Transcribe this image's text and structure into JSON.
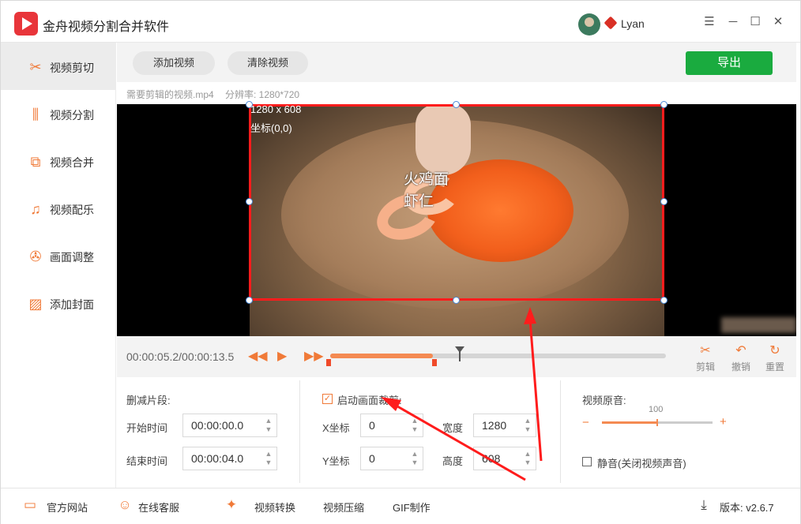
{
  "app": {
    "title": "金舟视频分割合并软件",
    "username": "Lyan"
  },
  "window": {
    "menu_icon": "hamburger-icon",
    "min_icon": "minimize-icon",
    "max_icon": "maximize-icon",
    "close_icon": "close-icon"
  },
  "sidebar": {
    "items": [
      {
        "label": "视频剪切",
        "icon": "scissors-icon",
        "active": true
      },
      {
        "label": "视频分割",
        "icon": "split-icon",
        "active": false
      },
      {
        "label": "视频合并",
        "icon": "merge-icon",
        "active": false
      },
      {
        "label": "视频配乐",
        "icon": "music-icon",
        "active": false
      },
      {
        "label": "画面调整",
        "icon": "film-reel-icon",
        "active": false
      },
      {
        "label": "添加封面",
        "icon": "image-icon",
        "active": false
      }
    ]
  },
  "toolbar": {
    "add_video": "添加视频",
    "clear_video": "清除视频",
    "export": "导出"
  },
  "file": {
    "name": "需要剪辑的视频.mp4",
    "resolution": "分辨率: 1280*720"
  },
  "preview": {
    "crop_size": "1280 x 608",
    "crop_coord": "坐标(0,0)",
    "subtitle_line1": "火鸡面",
    "subtitle_line2": "虾仁"
  },
  "playback": {
    "timecode": "00:00:05.2/00:00:13.5",
    "progress": 0.385,
    "played": 0.305,
    "segment_start": 0.0,
    "segment_end": 0.31
  },
  "tools": {
    "cut": "剪辑",
    "undo": "撤销",
    "reset": "重置"
  },
  "trim": {
    "title": "删减片段:",
    "start_label": "开始时间",
    "start_value": "00:00:00.0",
    "end_label": "结束时间",
    "end_value": "00:00:04.0"
  },
  "crop": {
    "enable_label": "启动画面裁剪:",
    "enabled": true,
    "x_label": "X坐标",
    "x_value": "0",
    "y_label": "Y坐标",
    "y_value": "0",
    "width_label": "宽度",
    "width_value": "1280",
    "height_label": "高度",
    "height_value": "608"
  },
  "audio": {
    "title": "视频原音:",
    "volume": "100",
    "volume_fraction": 0.5,
    "mute_label": "静音(关闭视频声音)",
    "muted": false,
    "minus": "−",
    "plus": "+"
  },
  "statusbar": {
    "website": "官方网站",
    "support": "在线客服",
    "convert": "视频转换",
    "compress": "视频压缩",
    "gif": "GIF制作",
    "version": "版本: v2.6.7"
  }
}
